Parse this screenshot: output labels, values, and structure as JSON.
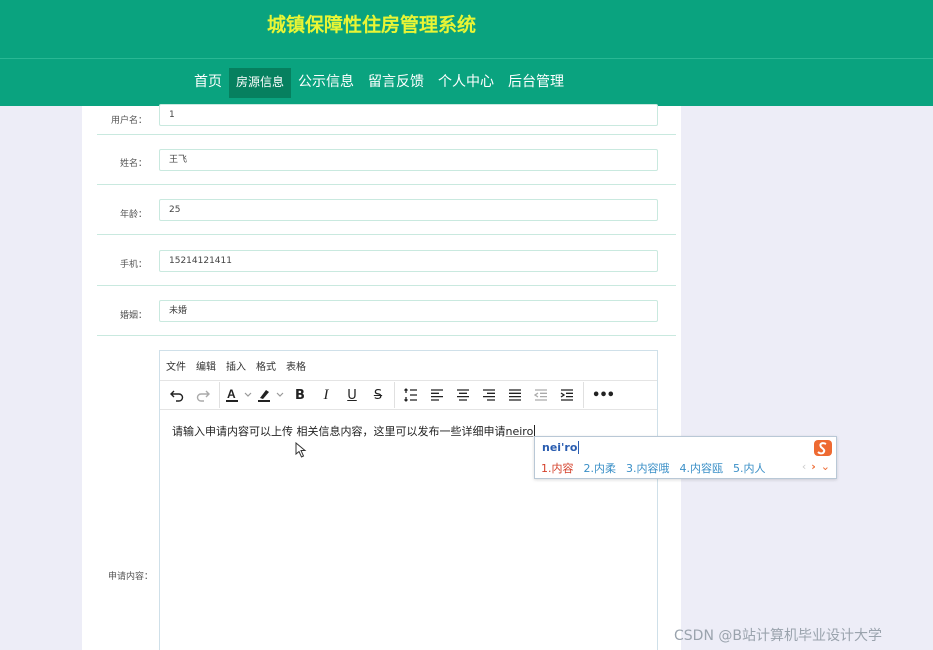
{
  "header": {
    "title": "城镇保障性住房管理系统",
    "nav": [
      "首页",
      "房源信息",
      "公示信息",
      "留言反馈",
      "个人中心",
      "后台管理"
    ],
    "active_index": 1
  },
  "form": {
    "username_label": "用户名：",
    "username_value": "1",
    "name_label": "姓名：",
    "name_value": "王飞",
    "age_label": "年龄：",
    "age_value": "25",
    "phone_label": "手机：",
    "phone_value": "15214121411",
    "marriage_label": "婚姻：",
    "marriage_value": "未婚",
    "apply_label": "申请内容："
  },
  "editor": {
    "menu": [
      "文件",
      "编辑",
      "插入",
      "格式",
      "表格"
    ],
    "content_text": "请输入申请内容可以上传 相关信息内容，这里可以发布一些详细申请",
    "composing_text": "neiro"
  },
  "ime": {
    "pinyin": "nei'ro",
    "candidates": [
      "1.内容",
      "2.内柔",
      "3.内容哦",
      "4.内容瓯",
      "5.内人"
    ]
  },
  "watermark": "CSDN @B站计算机毕业设计大学",
  "colors": {
    "header": "#0aa37f",
    "title": "#e8f535",
    "active_nav": "#06805f",
    "border": "#c9e9df"
  }
}
